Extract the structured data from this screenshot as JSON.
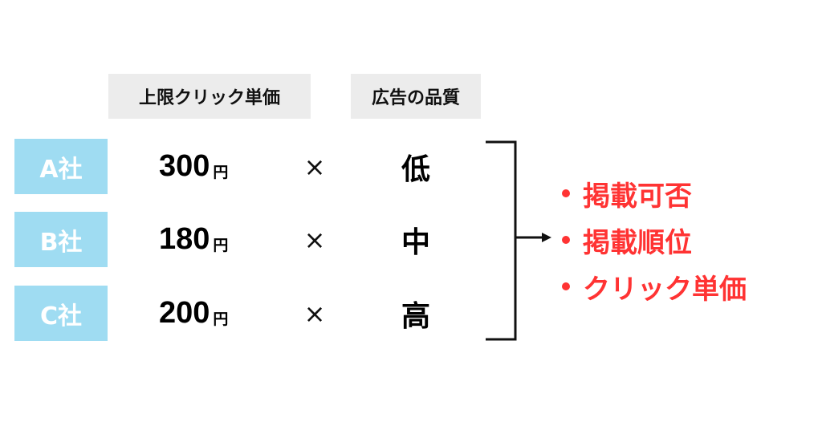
{
  "headers": {
    "max_cpc": "上限クリック単価",
    "ad_quality": "広告の品質"
  },
  "rows": [
    {
      "company": "A社",
      "price": "300",
      "unit": "円",
      "operator": "×",
      "quality": "低"
    },
    {
      "company": "B社",
      "price": "180",
      "unit": "円",
      "operator": "×",
      "quality": "中"
    },
    {
      "company": "C社",
      "price": "200",
      "unit": "円",
      "operator": "×",
      "quality": "高"
    }
  ],
  "results": [
    "掲載可否",
    "掲載順位",
    "クリック単価"
  ],
  "colors": {
    "company_badge": "#9fdcf2",
    "header_bg": "#ececec",
    "result_text": "#ff3333"
  }
}
